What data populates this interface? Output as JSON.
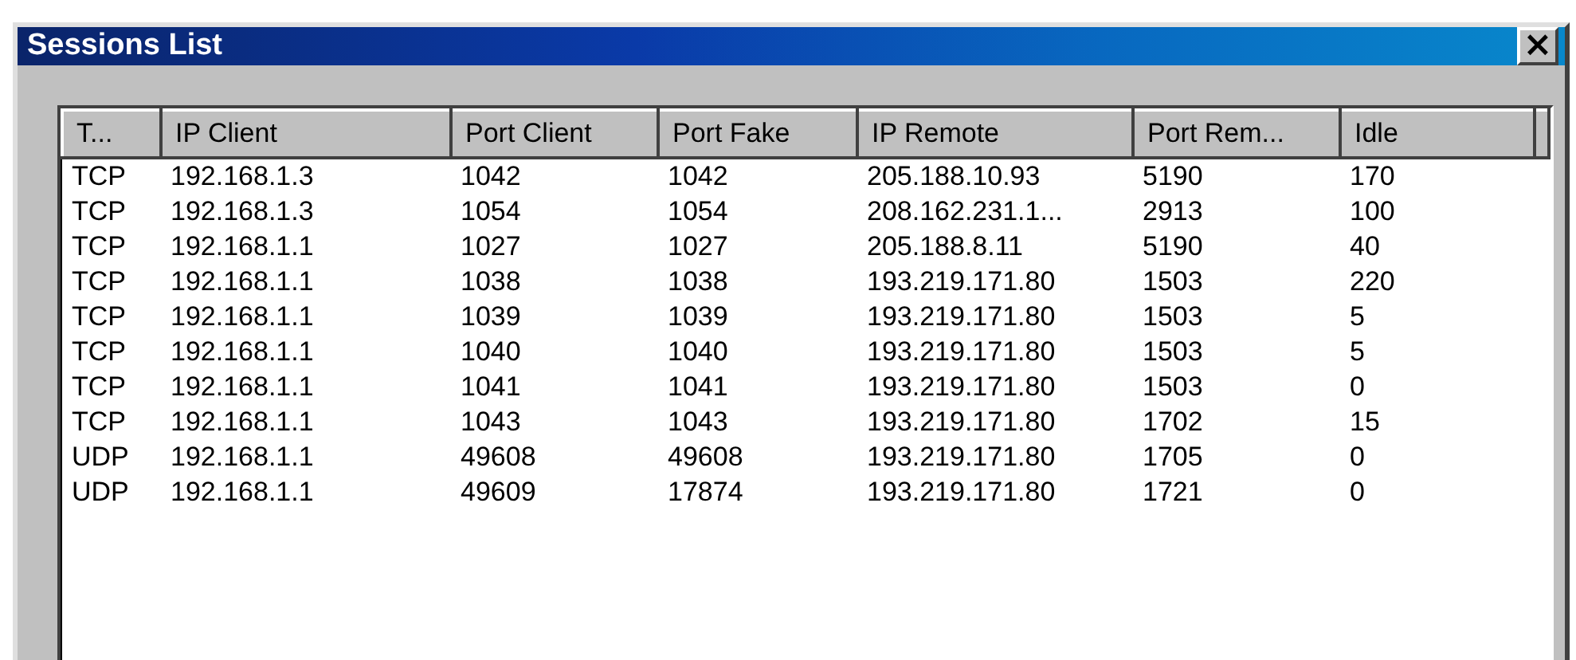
{
  "window": {
    "title": "Sessions List",
    "close": "×"
  },
  "table": {
    "columns": [
      "T...",
      "IP Client",
      "Port Client",
      "Port Fake",
      "IP Remote",
      "Port Rem...",
      "Idle"
    ],
    "rows": [
      [
        "TCP",
        "192.168.1.3",
        "1042",
        "1042",
        "205.188.10.93",
        "5190",
        "170"
      ],
      [
        "TCP",
        "192.168.1.3",
        "1054",
        "1054",
        "208.162.231.1...",
        "2913",
        "100"
      ],
      [
        "TCP",
        "192.168.1.1",
        "1027",
        "1027",
        "205.188.8.11",
        "5190",
        "40"
      ],
      [
        "TCP",
        "192.168.1.1",
        "1038",
        "1038",
        "193.219.171.80",
        "1503",
        "220"
      ],
      [
        "TCP",
        "192.168.1.1",
        "1039",
        "1039",
        "193.219.171.80",
        "1503",
        "5"
      ],
      [
        "TCP",
        "192.168.1.1",
        "1040",
        "1040",
        "193.219.171.80",
        "1503",
        "5"
      ],
      [
        "TCP",
        "192.168.1.1",
        "1041",
        "1041",
        "193.219.171.80",
        "1503",
        "0"
      ],
      [
        "TCP",
        "192.168.1.1",
        "1043",
        "1043",
        "193.219.171.80",
        "1702",
        "15"
      ],
      [
        "UDP",
        "192.168.1.1",
        "49608",
        "49608",
        "193.219.171.80",
        "1705",
        "0"
      ],
      [
        "UDP",
        "192.168.1.1",
        "49609",
        "17874",
        "193.219.171.80",
        "1721",
        "0"
      ]
    ]
  }
}
